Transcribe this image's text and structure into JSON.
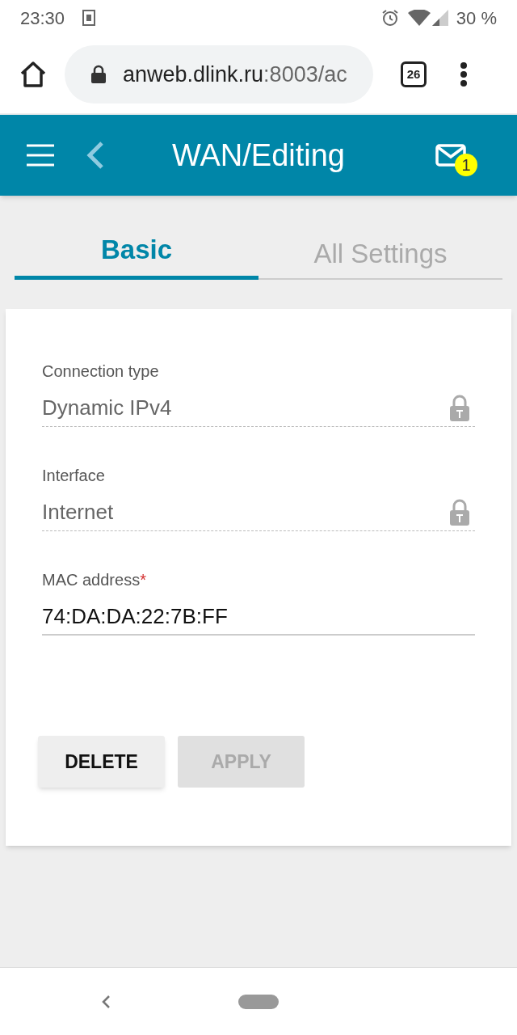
{
  "status_bar": {
    "time": "23:30",
    "battery": "30 %"
  },
  "browser": {
    "url_host": "anweb.dlink.ru",
    "url_rest": ":8003/ac",
    "tab_count": "26"
  },
  "header": {
    "title": "WAN/Editing",
    "message_count": "1"
  },
  "tabs": [
    {
      "label": "Basic",
      "selected": true
    },
    {
      "label": "All Settings",
      "selected": false
    }
  ],
  "fields": [
    {
      "label": "Connection type",
      "value": "Dynamic IPv4",
      "locked": true
    },
    {
      "label": "Interface",
      "value": "Internet",
      "locked": true
    },
    {
      "label": "MAC address",
      "required_mark": "*",
      "value": "74:DA:DA:22:7B:FF",
      "locked": false
    }
  ],
  "buttons": [
    {
      "label": "DELETE",
      "disabled": false
    },
    {
      "label": "APPLY",
      "disabled": true
    }
  ]
}
